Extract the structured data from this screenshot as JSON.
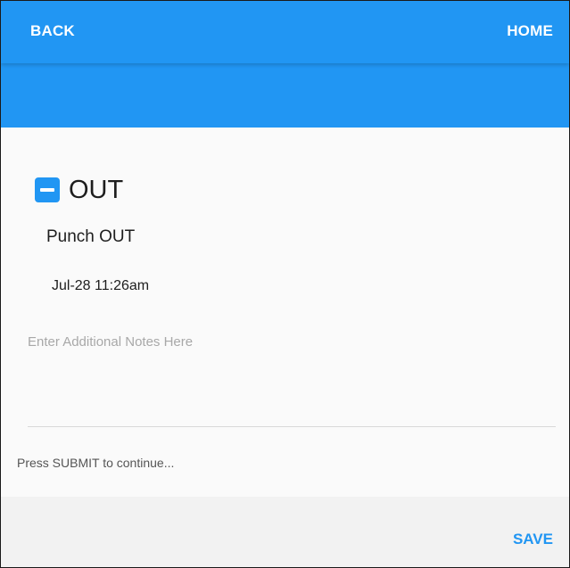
{
  "header": {
    "back_label": "BACK",
    "home_label": "HOME"
  },
  "punch": {
    "title": "OUT",
    "subtitle": "Punch OUT",
    "timestamp": "Jul-28 11:26am"
  },
  "notes": {
    "value": "",
    "placeholder": "Enter Additional Notes Here"
  },
  "instructions": "Press SUBMIT to continue...",
  "footer": {
    "save_label": "SAVE"
  },
  "colors": {
    "accent": "#2196f3",
    "background": "#fafafa",
    "footer_background": "#f2f2f2"
  },
  "icons": {
    "punch_checkbox": "minus-square-icon"
  }
}
